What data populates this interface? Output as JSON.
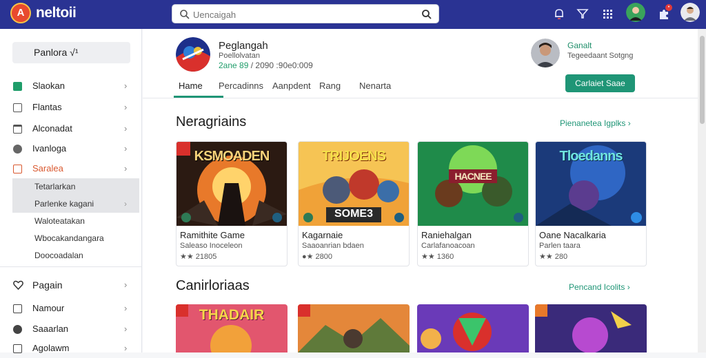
{
  "header": {
    "logo_letter": "A",
    "app_name": "neltoii",
    "search_placeholder": "Uencaigah"
  },
  "sidebar": {
    "header_label": "Panlora √¹",
    "items": [
      {
        "label": "Slaokan",
        "icon": "game-icon",
        "color": "#1f9d6a"
      },
      {
        "label": "Flantas",
        "icon": "grid-icon",
        "color": "#555555"
      },
      {
        "label": "Alconadat",
        "icon": "folder-icon",
        "color": "#555555"
      },
      {
        "label": "Ivanloga",
        "icon": "controller-icon",
        "color": "#555555"
      },
      {
        "label": "Saralea",
        "icon": "category-icon",
        "color": "#d9582f"
      }
    ],
    "subitems": [
      {
        "label": "Tetarlarkan"
      },
      {
        "label": "Parlenke kagani"
      },
      {
        "label": "Waloteatakan"
      },
      {
        "label": "Wbocakandangara"
      },
      {
        "label": "Doocoadalan"
      }
    ],
    "bottom_items": [
      {
        "label": "Pagain",
        "icon": "heart-icon"
      },
      {
        "label": "Namour",
        "icon": "tag-icon"
      },
      {
        "label": "Saaarlan",
        "icon": "compass-icon"
      },
      {
        "label": "Agolawm",
        "icon": "lock-icon"
      }
    ]
  },
  "game": {
    "title": "Peglangah",
    "subtitle": "Poellolvatan",
    "rating": "2ane 89",
    "stats": "/ 2090 :90e0:009"
  },
  "developer": {
    "name": "Ganalt",
    "subtitle": "Tegeedaant Sotgng"
  },
  "cta_label": "Carlaiet Saae",
  "tabs": [
    {
      "label": "Hame"
    },
    {
      "label": "Percadinns"
    },
    {
      "label": "Aanpdent"
    },
    {
      "label": "Rang"
    },
    {
      "label": "Nenarta"
    }
  ],
  "sections": [
    {
      "title": "Neragriains",
      "link": "Pienanetea Igplks",
      "cards": [
        {
          "thumb_text": "KSMOADEN",
          "title": "Ramithite Game",
          "sub": "Saleaso Inoceleon",
          "rating": "★★ 21805"
        },
        {
          "thumb_text": "TRIJOENS",
          "title": "Kagarnaie",
          "sub": "Saaoanrian bdaen",
          "rating": "●★ 2800"
        },
        {
          "thumb_text": "HACNEE",
          "title": "Raniehalgan",
          "sub": "Carlafanoacoan",
          "rating": "★★ 1360"
        },
        {
          "thumb_text": "Tloedanns",
          "title": "Oane Nacalkaria",
          "sub": "Parlen taara",
          "rating": "★★ 280"
        }
      ]
    },
    {
      "title": "Canirloriaas",
      "link": "Pencand Icolits",
      "cards": [
        {
          "thumb_text": "THADAIR"
        },
        {
          "thumb_text": ""
        },
        {
          "thumb_text": ""
        },
        {
          "thumb_text": ""
        }
      ]
    }
  ],
  "colors": {
    "topbar": "#2a3393",
    "accent": "#1f9576",
    "star": "#e3a825"
  }
}
